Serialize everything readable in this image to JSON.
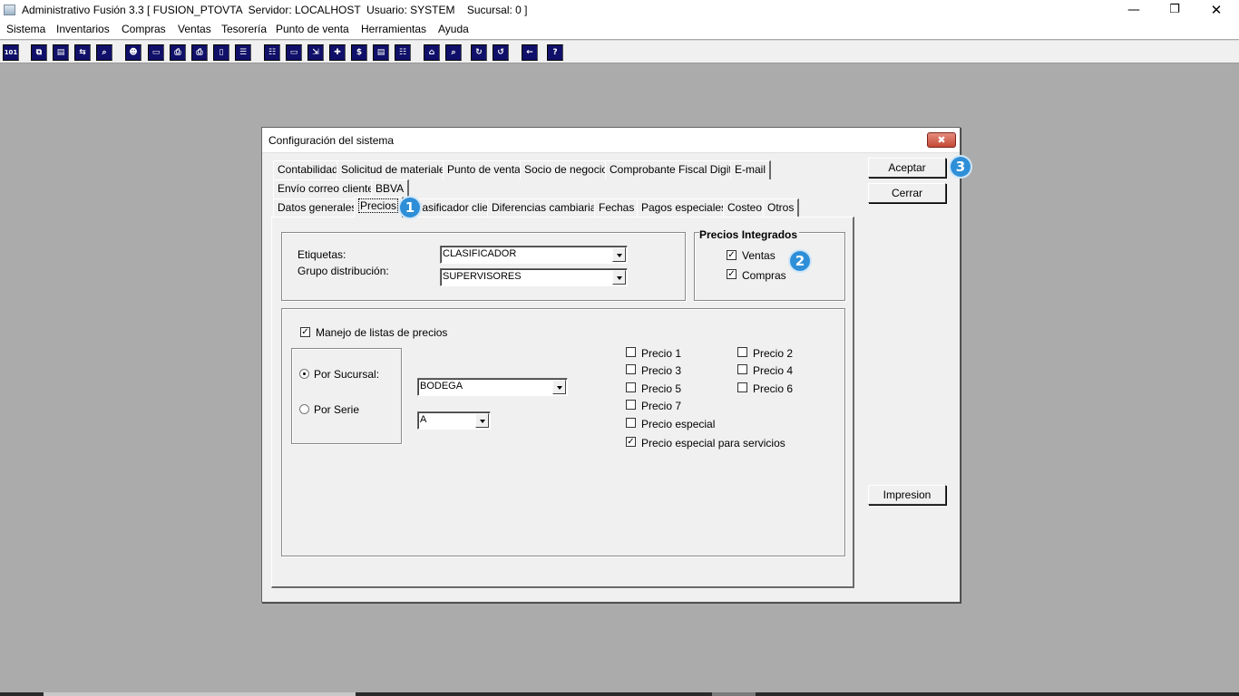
{
  "window": {
    "title": "Administrativo Fusión 3.3 [ FUSION_PTOVTA  Servidor: LOCALHOST  Usuario: SYSTEM    Sucursal: 0 ]",
    "minimize": "—",
    "restore": "❐",
    "close": "✕"
  },
  "menu": [
    "Sistema",
    "Inventarios",
    "Compras",
    "Ventas",
    "Tesorería",
    "Punto de venta",
    "Herramientas",
    "Ayuda"
  ],
  "toolbar": {
    "icons": [
      "calculator-icon",
      "copy-icon",
      "clipboard-icon",
      "transfer-icon",
      "zoom-icon",
      "user-icon",
      "folder-icon",
      "print-icon",
      "printer-icon",
      "document-icon",
      "list-icon",
      "people-icon",
      "window-icon",
      "export-icon",
      "add-icon",
      "money-icon",
      "report-icon",
      "table-icon",
      "home-icon",
      "search-icon",
      "refresh-icon",
      "undo-icon",
      "back-icon",
      "help-icon"
    ],
    "glyphs": [
      "101",
      "⧉",
      "▤",
      "⇆",
      "⌕",
      "☻",
      "▭",
      "⎙",
      "⎙",
      "▯",
      "☰",
      "☷",
      "▭",
      "⇲",
      "✚",
      "$",
      "▤",
      "☷",
      "⌂",
      "⌕",
      "↻",
      "↺",
      "←",
      "?"
    ]
  },
  "dialog": {
    "title": "Configuración del sistema",
    "close": "✖",
    "tabs_row1": [
      "Contabilidad",
      "Solicitud de materiales",
      "Punto de venta",
      "Socio de negocio",
      "Comprobante Fiscal Digital",
      "E-mail"
    ],
    "tabs_row2": [
      "Envío correo cliente",
      "BBVA"
    ],
    "tabs_row3": [
      "Datos generales",
      "Precios",
      "Clasificador cliente",
      "Diferencias cambiarias",
      "Fechas",
      "Pagos especiales",
      "Costeo",
      "Otros"
    ],
    "active_tab": "Precios",
    "general": {
      "etiquetas_label": "Etiquetas:",
      "etiquetas_value": "CLASIFICADOR",
      "grupo_label": "Grupo distribución:",
      "grupo_value": "SUPERVISORES"
    },
    "integrados": {
      "title": "Precios Integrados",
      "ventas": {
        "label": "Ventas",
        "checked": true
      },
      "compras": {
        "label": "Compras",
        "checked": true
      }
    },
    "listas": {
      "manejo_label": "Manejo de listas de precios",
      "manejo_checked": true,
      "por_sucursal": "Por Sucursal:",
      "por_serie": "Por Serie",
      "selected": "sucursal",
      "sucursal_value": "BODEGA",
      "serie_value": "A",
      "precios": [
        {
          "label": "Precio 1",
          "checked": false
        },
        {
          "label": "Precio 2",
          "checked": false
        },
        {
          "label": "Precio 3",
          "checked": false
        },
        {
          "label": "Precio 4",
          "checked": false
        },
        {
          "label": "Precio 5",
          "checked": false
        },
        {
          "label": "Precio 6",
          "checked": false
        },
        {
          "label": "Precio 7",
          "checked": false
        },
        {
          "label": "Precio especial",
          "checked": false
        },
        {
          "label": "Precio especial para servicios",
          "checked": true
        }
      ]
    },
    "buttons": {
      "aceptar": "Aceptar",
      "cerrar": "Cerrar",
      "impresion": "Impresion"
    }
  },
  "badges": [
    "1",
    "2",
    "3"
  ],
  "check_mark": "✓"
}
